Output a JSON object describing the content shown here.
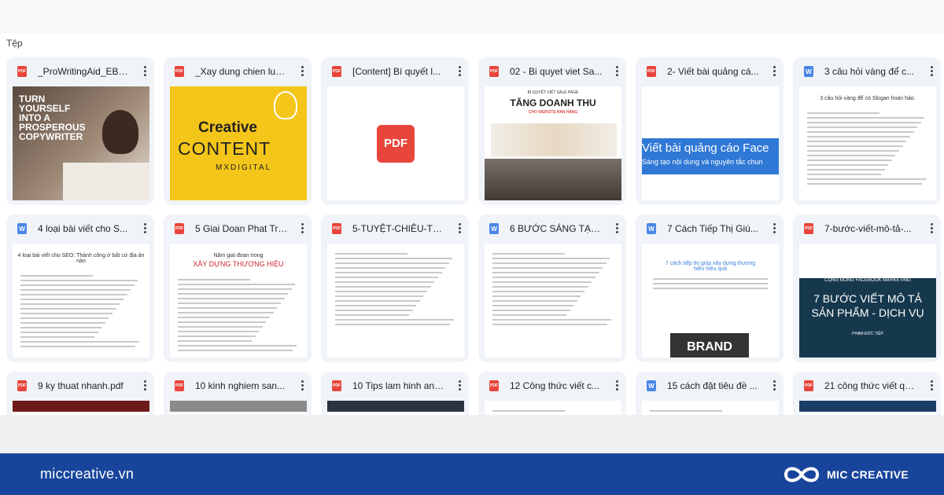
{
  "section_label": "Tệp",
  "files": [
    {
      "title": "_ProWritingAid_EBo...",
      "type": "pdf",
      "icon": "pdf-icon",
      "thumb": "copywriter",
      "thumb_text": [
        "TURN",
        "YOURSELF",
        "INTO A",
        "PROSPEROUS",
        "COPYWRITER"
      ]
    },
    {
      "title": "_Xay dung chien luo...",
      "type": "pdf",
      "icon": "pdf-icon",
      "thumb": "creative",
      "thumb_text": [
        "Creative",
        "CONTENT",
        "MXDIGITAL"
      ]
    },
    {
      "title": "[Content] Bí quyết l...",
      "type": "pdf",
      "icon": "pdf-icon",
      "thumb": "pdfbadge",
      "thumb_text": [
        "PDF"
      ]
    },
    {
      "title": "02 - Bi quyet viet Sa...",
      "type": "pdf",
      "icon": "pdf-icon",
      "thumb": "salespage",
      "thumb_text": [
        "BÍ QUYẾT VIẾT SALE PAGE",
        "TĂNG DOANH THU",
        "CHO WEBSITE BÁN HÀNG"
      ]
    },
    {
      "title": "2- Viết bài quảng cá...",
      "type": "pdf",
      "icon": "pdf-icon",
      "thumb": "fbads",
      "thumb_text": [
        "Viết bài quảng cáo Face",
        "Sáng tạo nội dung và nguyên tắc chun"
      ]
    },
    {
      "title": "3 câu hỏi vàng để c...",
      "type": "doc",
      "icon": "docs-icon",
      "thumb": "doc",
      "thumb_text": [
        "3 câu hỏi vàng để có Slogan hoàn hảo."
      ]
    },
    {
      "title": "4 loại bài viết cho S...",
      "type": "doc",
      "icon": "docs-icon",
      "thumb": "doc",
      "thumb_text": [
        "4 loại bài viết cho SEO: Thành công ở bất cứ địa ản nào"
      ]
    },
    {
      "title": "5 Giai Doan Phat Tri...",
      "type": "pdf",
      "icon": "pdf-icon",
      "thumb": "doc",
      "thumb_text": [
        "Năm giai đoạn trong",
        "XÂY DỰNG THƯƠNG HIỆU"
      ]
    },
    {
      "title": "5-TUYỆT-CHIÊU-TĂN...",
      "type": "pdf",
      "icon": "pdf-icon",
      "thumb": "doc",
      "thumb_text": []
    },
    {
      "title": "6 BƯỚC SÁNG TẠO ...",
      "type": "doc",
      "icon": "docs-icon",
      "thumb": "doc",
      "thumb_text": []
    },
    {
      "title": "7 Cách Tiếp Thị Giú...",
      "type": "doc",
      "icon": "docs-icon",
      "thumb": "brand",
      "thumb_text": [
        "7 cách tiếp thị giúp xây dựng thương",
        "hiệu hiệu quả",
        "BRAND"
      ]
    },
    {
      "title": "7-bước-viết-mô-tả-...",
      "type": "pdf",
      "icon": "pdf-icon",
      "thumb": "steps",
      "thumb_text": [
        "CỘNG ĐỒNG FACEBOOK MARKETING",
        "7 BƯỚC VIẾT MÔ TẢ",
        "SẢN PHẨM - DỊCH VỤ",
        "PHẠM ĐỨC TIỆP"
      ]
    },
    {
      "title": "9 ky thuat nhanh.pdf",
      "type": "pdf",
      "icon": "pdf-icon",
      "thumb": "dark-red",
      "thumb_text": []
    },
    {
      "title": "10 kinh nghiem san...",
      "type": "pdf",
      "icon": "pdf-icon",
      "thumb": "grey",
      "thumb_text": []
    },
    {
      "title": "10 Tips lam hinh anh...",
      "type": "pdf",
      "icon": "pdf-icon",
      "thumb": "navy",
      "thumb_text": []
    },
    {
      "title": "12 Công thức viết c...",
      "type": "pdf",
      "icon": "pdf-icon",
      "thumb": "doc",
      "thumb_text": []
    },
    {
      "title": "15 cách đặt tiêu đề ...",
      "type": "doc",
      "icon": "docs-icon",
      "thumb": "doc",
      "thumb_text": []
    },
    {
      "title": "21 công thức viết qu...",
      "type": "pdf",
      "icon": "pdf-icon",
      "thumb": "blue",
      "thumb_text": []
    }
  ],
  "footer": {
    "site": "miccreative.vn",
    "brand": "MIC CREATIVE",
    "brand_icon": "infinity-logo-icon",
    "background": "#18459b"
  },
  "colors": {
    "pdf": "#e8453c",
    "doc": "#4a86e8",
    "card": "#f0f4f9"
  }
}
